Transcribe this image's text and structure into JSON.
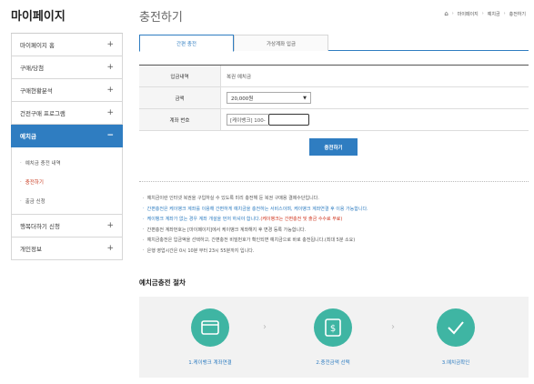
{
  "sidebar": {
    "title": "마이페이지",
    "items": [
      {
        "label": "마이페이지 홈",
        "sign": "+"
      },
      {
        "label": "구매/당첨",
        "sign": "+"
      },
      {
        "label": "구매현황분석",
        "sign": "+"
      },
      {
        "label": "건전구매 프로그램",
        "sign": "+"
      },
      {
        "label": "예치금",
        "sign": "−"
      }
    ],
    "sub_items": [
      {
        "label": "예치금 충전 내역"
      },
      {
        "label": "충전하기"
      },
      {
        "label": "출금 신청"
      }
    ],
    "bottom_items": [
      {
        "label": "행복더하기 신청",
        "sign": "+"
      },
      {
        "label": "개인정보",
        "sign": "+"
      }
    ]
  },
  "header": {
    "title": "충전하기",
    "breadcrumb": [
      "마이페이지",
      "예치금",
      "충전하기"
    ]
  },
  "tabs": [
    {
      "label": "간편 충전"
    },
    {
      "label": "가상계좌 입금"
    }
  ],
  "form": {
    "rows": [
      {
        "label": "입금내역",
        "value": "복권 예치금"
      },
      {
        "label": "금액",
        "value": "20,000원"
      },
      {
        "label": "계좌 번호",
        "value": "[케이뱅크] 100-"
      }
    ],
    "submit_label": "충전하기"
  },
  "notices": [
    {
      "text": "예치금이란 인터넷 복권을 구입하실 수 있도록 미리 충전해 둔 복권 구매용 결제수단입니다."
    },
    {
      "text": "간편충전은 케이뱅크 계좌를 이용해 간편하게 예치금을 충전하는 서비스이며, 케이뱅크 계좌연결 후 이용 가능합니다."
    },
    {
      "text": "케이뱅크 계좌가 없는 경우 계좌 개설을 먼저 하셔야 합니다.",
      "red": "(케이뱅크는 간편충전 및 출금 수수료 무료)"
    },
    {
      "text": "간편충전 계좌번호는 [마이페이지]에서 케이뱅크 계좌해지 후 변경 등록 가능합니다."
    },
    {
      "text": "예치금충전은 입금액을 선택하고, 간편충전 비밀번호가 확인되면 예치금으로 바로 충전됩니다.(최대 5분 소요)"
    },
    {
      "text": "은행 영업시간은 0시 10분 부터 23시 55분까지 입니다."
    }
  ],
  "steps": {
    "title": "예치금충전 절차",
    "items": [
      {
        "label": "1.케이뱅크 계좌연결",
        "icon": "card-icon"
      },
      {
        "label": "2.충전금액 선택",
        "icon": "won-bill-icon"
      },
      {
        "label": "3.예치금확인",
        "icon": "check-icon"
      }
    ]
  },
  "colors": {
    "accent": "#2f7dc1",
    "step_circle": "#3fb5a3",
    "warning_red": "#d0361f"
  }
}
